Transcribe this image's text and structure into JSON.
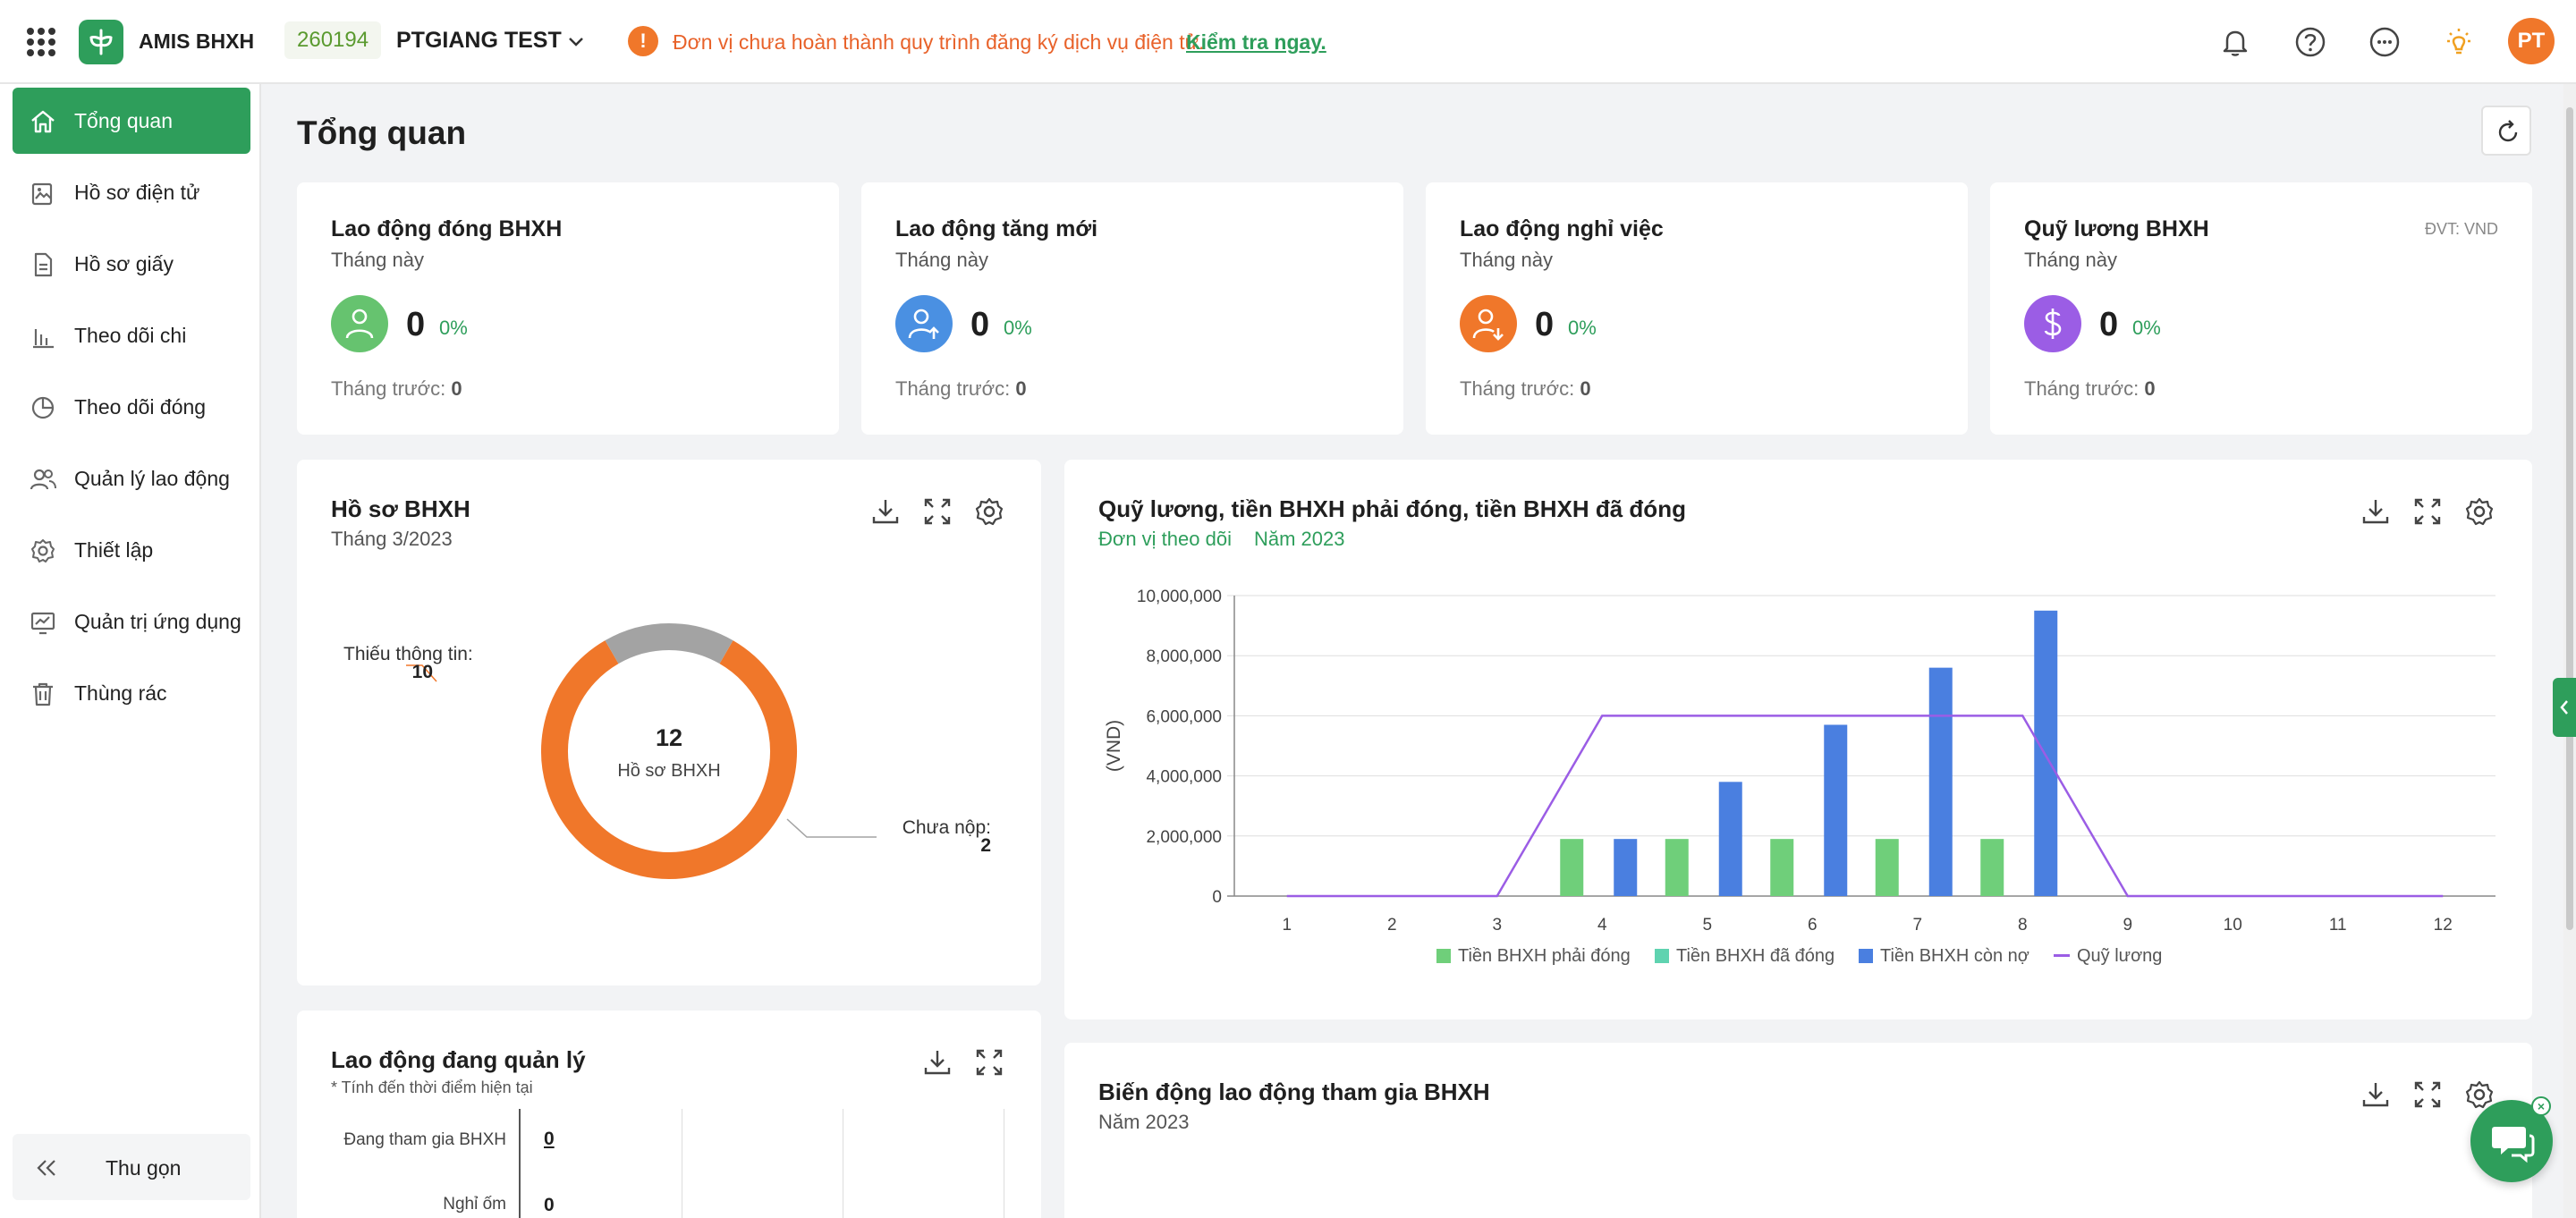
{
  "header": {
    "app_name": "AMIS BHXH",
    "org_code": "260194",
    "org_name": "PTGIANG TEST",
    "warning_text": "Đơn vị chưa hoàn thành quy trình đăng ký dịch vụ điện tử.",
    "warning_link": "Kiểm tra ngay.",
    "avatar_initials": "PT"
  },
  "sidebar": {
    "items": [
      {
        "label": "Tổng quan",
        "icon": "home-icon",
        "active": true
      },
      {
        "label": "Hồ sơ điện tử",
        "icon": "folder-image-icon"
      },
      {
        "label": "Hồ sơ giấy",
        "icon": "document-icon"
      },
      {
        "label": "Theo dõi chi",
        "icon": "bar-chart-icon"
      },
      {
        "label": "Theo dõi đóng",
        "icon": "pie-chart-icon"
      },
      {
        "label": "Quản lý lao động",
        "icon": "users-icon"
      },
      {
        "label": "Thiết lập",
        "icon": "gear-icon"
      },
      {
        "label": "Quản trị ứng dụng",
        "icon": "monitor-chart-icon"
      },
      {
        "label": "Thùng rác",
        "icon": "trash-icon"
      }
    ],
    "collapse_label": "Thu gọn"
  },
  "page": {
    "title": "Tổng quan"
  },
  "stats": [
    {
      "title": "Lao động đóng BHXH",
      "period": "Tháng này",
      "value": "0",
      "pct": "0%",
      "prev_label": "Tháng trước:",
      "prev_value": "0",
      "icon": "user-icon",
      "color": "#66c36f"
    },
    {
      "title": "Lao động tăng mới",
      "period": "Tháng này",
      "value": "0",
      "pct": "0%",
      "prev_label": "Tháng trước:",
      "prev_value": "0",
      "icon": "user-arrow-up-icon",
      "color": "#4a90e2"
    },
    {
      "title": "Lao động nghỉ việc",
      "period": "Tháng này",
      "value": "0",
      "pct": "0%",
      "prev_label": "Tháng trước:",
      "prev_value": "0",
      "icon": "user-arrow-down-icon",
      "color": "#f0772a"
    },
    {
      "title": "Quỹ lương BHXH",
      "period": "Tháng này",
      "value": "0",
      "pct": "0%",
      "prev_label": "Tháng trước:",
      "prev_value": "0",
      "icon": "dollar-icon",
      "color": "#9b5de5",
      "unit": "ĐVT: VND"
    }
  ],
  "donut_panel": {
    "title": "Hồ sơ BHXH",
    "subtitle": "Tháng 3/2023",
    "center_value": "12",
    "center_label": "Hồ sơ BHXH"
  },
  "combo_panel": {
    "title": "Quỹ lương, tiền BHXH phải đóng, tiền BHXH đã đóng",
    "filter_unit": "Đơn vị theo dõi",
    "filter_year": "Năm 2023"
  },
  "labor_panel": {
    "title": "Lao động đang quản lý",
    "note": "* Tính đến thời điểm hiện tại",
    "rows": [
      {
        "label": "Đang tham gia BHXH",
        "value": "0"
      },
      {
        "label": "Nghỉ ốm",
        "value": "0"
      }
    ]
  },
  "variation_panel": {
    "title": "Biến động lao động tham gia BHXH",
    "subtitle": "Năm 2023"
  },
  "chart_data": [
    {
      "type": "pie",
      "title": "Hồ sơ BHXH",
      "slices": [
        {
          "label": "Thiếu thông tin:",
          "value": 10,
          "color": "#f0772a"
        },
        {
          "label": "Chưa nộp:",
          "value": 2,
          "color": "#a3a3a3"
        }
      ]
    },
    {
      "type": "bar",
      "title": "Quỹ lương, tiền BHXH phải đóng, tiền BHXH đã đóng",
      "ylabel": "(VND)",
      "categories": [
        "1",
        "2",
        "3",
        "4",
        "5",
        "6",
        "7",
        "8",
        "9",
        "10",
        "11",
        "12"
      ],
      "ylim": [
        0,
        10000000
      ],
      "yticks": [
        "0",
        "2,000,000",
        "4,000,000",
        "6,000,000",
        "8,000,000",
        "10,000,000"
      ],
      "grid": true,
      "legend_position": "bottom",
      "series": [
        {
          "name": "Tiền BHXH phải đóng",
          "type": "bar",
          "color": "#6fcf7a",
          "values": [
            0,
            0,
            0,
            1900000,
            1900000,
            1900000,
            1900000,
            1900000,
            0,
            0,
            0,
            0
          ]
        },
        {
          "name": "Tiền BHXH đã đóng",
          "type": "bar",
          "color": "#5fd3b0",
          "values": [
            0,
            0,
            0,
            0,
            0,
            0,
            0,
            0,
            0,
            0,
            0,
            0
          ]
        },
        {
          "name": "Tiền BHXH còn nợ",
          "type": "bar",
          "color": "#4a7fe0",
          "values": [
            0,
            0,
            0,
            1900000,
            3800000,
            5700000,
            7600000,
            9500000,
            0,
            0,
            0,
            0
          ]
        },
        {
          "name": "Quỹ lương",
          "type": "line",
          "color": "#9b5de5",
          "values": [
            0,
            0,
            0,
            6000000,
            6000000,
            6000000,
            6000000,
            6000000,
            0,
            0,
            0,
            0
          ]
        }
      ]
    }
  ]
}
